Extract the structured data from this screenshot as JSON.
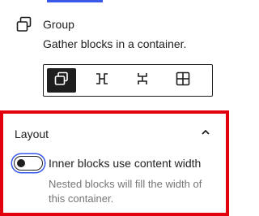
{
  "block": {
    "title": "Group",
    "description": "Gather blocks in a container.",
    "icon": "group-icon",
    "variations": [
      {
        "name": "group",
        "icon": "group-variation-icon",
        "active": true
      },
      {
        "name": "row",
        "icon": "row-variation-icon",
        "active": false
      },
      {
        "name": "stack",
        "icon": "stack-variation-icon",
        "active": false
      },
      {
        "name": "grid",
        "icon": "grid-variation-icon",
        "active": false
      }
    ]
  },
  "layout_panel": {
    "title": "Layout",
    "expanded": true,
    "toggle": {
      "label": "Inner blocks use content width",
      "checked": false
    },
    "help": "Nested blocks will fill the width of this container."
  },
  "colors": {
    "accent": "#3858e9",
    "highlight_border": "#e2000c",
    "text": "#1e1e1e",
    "muted": "#757575"
  }
}
